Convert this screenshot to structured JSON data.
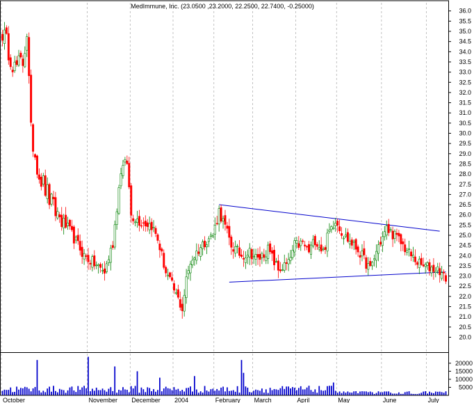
{
  "chart_data": {
    "type": "candlestick",
    "title": "MedImmune, Inc. (23.0500 ,23.2000, 22.2500, 22.7400, -0.25000)",
    "price_axis": {
      "position": "right",
      "ylim": [
        19.3,
        36.4
      ],
      "ticks": [
        "20.0",
        "20.5",
        "21.0",
        "21.5",
        "22.0",
        "22.5",
        "23.0",
        "23.5",
        "24.0",
        "24.5",
        "25.0",
        "25.5",
        "26.0",
        "26.5",
        "27.0",
        "27.5",
        "28.0",
        "28.5",
        "29.0",
        "29.5",
        "30.0",
        "30.5",
        "31.0",
        "31.5",
        "32.0",
        "32.5",
        "33.0",
        "33.5",
        "34.0",
        "34.5",
        "35.0",
        "35.5",
        "36.0"
      ]
    },
    "volume_axis": {
      "position": "right",
      "ylim": [
        0,
        26000
      ],
      "ticks": [
        "5000",
        "10000",
        "15000",
        "20000"
      ]
    },
    "x_axis": {
      "labels": [
        "October",
        "November",
        "December",
        "2004",
        "February",
        "March",
        "April",
        "May",
        "June",
        "July"
      ],
      "label_index": [
        0,
        42,
        63,
        84,
        104,
        123,
        144,
        164,
        186,
        208
      ],
      "count": 218
    },
    "colors": {
      "up": "#008000",
      "down": "#ff0000",
      "trendline": "#0000cc",
      "grid": "#999999"
    },
    "trendlines": [
      {
        "name": "upper",
        "from": [
          106,
          26.5
        ],
        "to": [
          214,
          25.2
        ]
      },
      {
        "name": "lower",
        "from": [
          111,
          22.7
        ],
        "to": [
          217,
          23.2
        ]
      }
    ],
    "anchors": [
      [
        0,
        35.0
      ],
      [
        6,
        33.2
      ],
      [
        10,
        33.5
      ],
      [
        12,
        35.0
      ],
      [
        14,
        30.0
      ],
      [
        18,
        28.0
      ],
      [
        25,
        26.3
      ],
      [
        33,
        25.2
      ],
      [
        40,
        24.0
      ],
      [
        45,
        23.6
      ],
      [
        50,
        23.2
      ],
      [
        54,
        24.6
      ],
      [
        58,
        28.2
      ],
      [
        61,
        28.6
      ],
      [
        63,
        26.0
      ],
      [
        67,
        25.7
      ],
      [
        73,
        25.5
      ],
      [
        76,
        24.8
      ],
      [
        80,
        23.2
      ],
      [
        84,
        22.3
      ],
      [
        88,
        21.4
      ],
      [
        90,
        22.8
      ],
      [
        92,
        23.7
      ],
      [
        96,
        24.3
      ],
      [
        100,
        24.8
      ],
      [
        103,
        25.0
      ],
      [
        106,
        26.2
      ],
      [
        109,
        25.4
      ],
      [
        112,
        24.5
      ],
      [
        117,
        24.0
      ],
      [
        121,
        24.2
      ],
      [
        125,
        23.8
      ],
      [
        130,
        24.3
      ],
      [
        135,
        23.3
      ],
      [
        140,
        23.6
      ],
      [
        143,
        24.5
      ],
      [
        147,
        24.6
      ],
      [
        150,
        24.2
      ],
      [
        153,
        24.8
      ],
      [
        157,
        24.2
      ],
      [
        160,
        25.2
      ],
      [
        163,
        25.8
      ],
      [
        167,
        25.0
      ],
      [
        171,
        24.6
      ],
      [
        174,
        24.3
      ],
      [
        177,
        23.8
      ],
      [
        180,
        23.3
      ],
      [
        184,
        24.5
      ],
      [
        188,
        25.3
      ],
      [
        192,
        25.0
      ],
      [
        196,
        24.5
      ],
      [
        200,
        24.0
      ],
      [
        205,
        23.5
      ],
      [
        210,
        23.4
      ],
      [
        214,
        23.3
      ],
      [
        217,
        22.74
      ]
    ],
    "volume_spikes": [
      [
        17,
        22000
      ],
      [
        42,
        24000
      ],
      [
        55,
        18000
      ],
      [
        66,
        15000
      ],
      [
        77,
        11000
      ],
      [
        94,
        12000
      ],
      [
        117,
        22000
      ],
      [
        118,
        14000
      ],
      [
        162,
        8000
      ]
    ]
  }
}
